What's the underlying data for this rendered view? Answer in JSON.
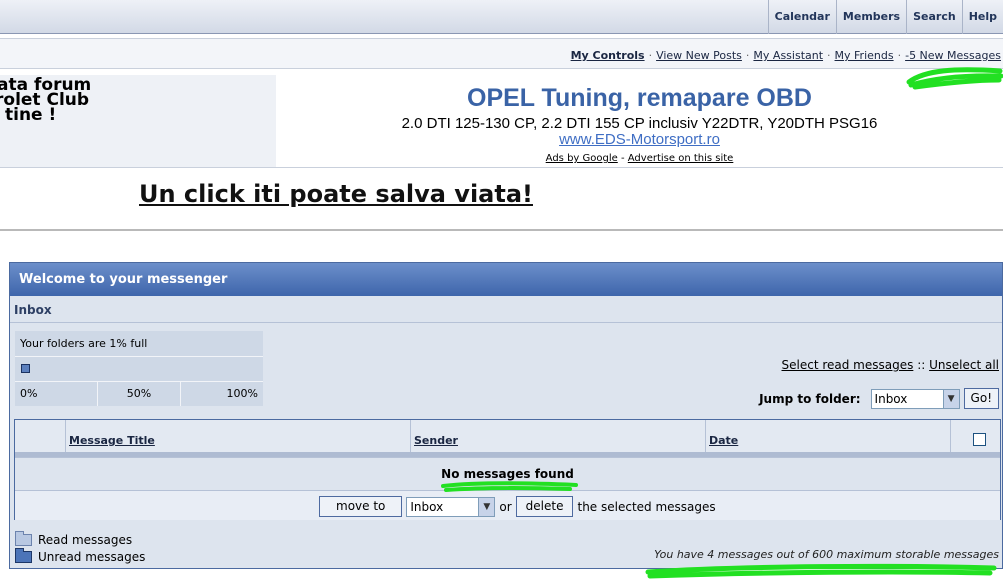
{
  "topnav": {
    "links": [
      "Calendar",
      "Members",
      "Search",
      "Help"
    ]
  },
  "userbar": {
    "my_controls": "My Controls",
    "view_new_posts": "View New Posts",
    "my_assistant": "My Assistant",
    "my_friends": "My Friends",
    "new_messages": "-5 New Messages",
    "separator": "·"
  },
  "banner": {
    "lines": [
      "ata forum",
      "rolet Club",
      "tine !"
    ]
  },
  "ad": {
    "title": "OPEL Tuning, remapare OBD",
    "description": "2.0 DTI 125-130 CP, 2.2 DTI 155 CP inclusiv Y22DTR, Y20DTH PSG16",
    "url": "www.EDS-Motorsport.ro",
    "ads_by_google": "Ads by Google",
    "dash": "-",
    "advertise": "Advertise on this site"
  },
  "slogan": "Un click iti poate salva viata!",
  "messenger": {
    "header": "Welcome to your messenger",
    "folder_title": "Inbox",
    "quota": {
      "text": "Your folders are 1% full",
      "fill_percent": 1,
      "scale": [
        "0%",
        "50%",
        "100%"
      ]
    },
    "select_read": "Select read messages",
    "select_sep": "::",
    "unselect_all": "Unselect all",
    "jump": {
      "label": "Jump to folder:",
      "selected": "Inbox",
      "go": "Go!"
    },
    "table": {
      "col_title": "Message Title",
      "col_sender": "Sender",
      "col_date": "Date",
      "empty": "No messages found"
    },
    "actions": {
      "move_to": "move to",
      "folder": "Inbox",
      "or": "or",
      "delete": "delete",
      "suffix": "the selected messages"
    },
    "legend": {
      "read": "Read messages",
      "unread": "Unread messages"
    },
    "storage": "You have 4 messages out of 600 maximum storable messages"
  },
  "colors": {
    "accent": "#3e65ab",
    "panel": "#dde4ee",
    "highlight": "#22e022"
  }
}
